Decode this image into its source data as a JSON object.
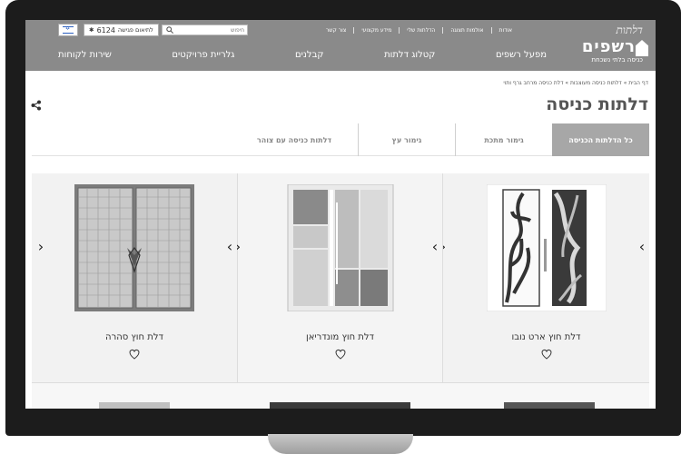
{
  "header": {
    "logo_script": "דלתות",
    "logo_main": "רשפים",
    "logo_tagline": "כניסה בלתי נשכחת",
    "top_links": [
      "אודות",
      "אולמות תצוגה",
      "הדלתות שלי",
      "מידע מקצועי",
      "צור קשר"
    ],
    "search_placeholder": "חיפוש",
    "phone_label": "לתיאום פגישה",
    "phone_number": "6124",
    "nav": [
      "מפעל רשפים",
      "קטלוג דלתות",
      "קבלנים",
      "גלריית פרויקטים",
      "שירות לקוחות"
    ]
  },
  "breadcrumb": "דף הבית » דלתות כניסה מעוצבות » דלת כניסה מרחב גרף ותוי",
  "page_title": "דלתות כניסה",
  "tabs": [
    {
      "label": "כל הדלתות הכניסה",
      "active": true
    },
    {
      "label": "גימור מתכת",
      "active": false
    },
    {
      "label": "גימור עץ",
      "active": false
    },
    {
      "label": "דלתות כניסה עם צוהר",
      "active": false
    }
  ],
  "products": [
    {
      "name": "דלת חוץ ארט נובו",
      "icon": "heart-icon"
    },
    {
      "name": "דלת חוץ מונדריאן",
      "icon": "heart-icon"
    },
    {
      "name": "דלת חוץ סהרה",
      "icon": "heart-icon"
    }
  ],
  "colors": {
    "header_bg": "#8a8a8a",
    "active_tab": "#a7a7a7",
    "card_bg": "#f2f2f2"
  }
}
